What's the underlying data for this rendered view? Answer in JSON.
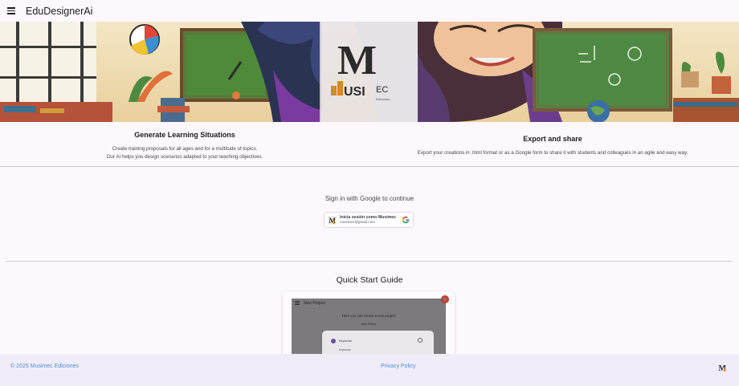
{
  "app": {
    "title": "EduDesignerAi"
  },
  "banner": {
    "logo_text": "USIMEC Ediciones"
  },
  "features": [
    {
      "title": "Generate Learning Situations",
      "lines": [
        "Create training proposals for all ages and for a multitude of topics.",
        "Our AI helps you design scenarios adapted to your teaching objectives."
      ]
    },
    {
      "title": "Export and share",
      "lines": [
        "Export your creations in .html format or as a Google form to share it with students and colleagues in an agile and easy way."
      ]
    }
  ],
  "signin": {
    "prompt": "Sign in with Google to continue",
    "button_name": "Inicia sesión como Musimec",
    "button_email": "musimec@gmail.com"
  },
  "guide": {
    "title": "Quick Start Guide",
    "screenshot": {
      "bar_title": "New Project",
      "heading": "Here you can create a new project",
      "subheading": "New Reflexl",
      "item1": "Keywords",
      "item2": "Keywords"
    }
  },
  "footer": {
    "copyright": "© 2025 Musimec Ediciones",
    "privacy": "Privacy Policy"
  },
  "icons": {
    "menu": "menu-icon",
    "google": "google-g-icon",
    "logo": "musimec-logo-icon"
  },
  "colors": {
    "background": "#fdf8fd",
    "footer_bg": "#f1ecf7",
    "link": "#4a90d9"
  }
}
